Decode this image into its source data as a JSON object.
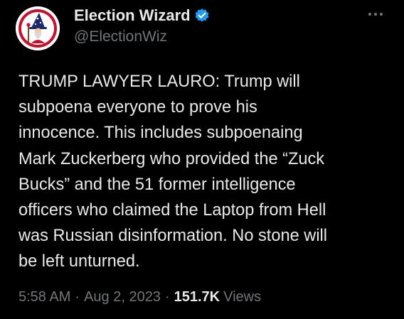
{
  "author": {
    "display_name": "Election Wizard",
    "handle": "@ElectionWiz",
    "verified_icon": "verified-badge-icon",
    "avatar_icon": "wizard-avatar"
  },
  "tweet": {
    "text": "TRUMP LAWYER LAURO: Trump will\nsubpoena everyone to prove his\ninnocence. This includes subpoenaing\nMark Zuckerberg who provided the “Zuck\nBucks” and the 51 former intelligence\nofficers who claimed the Laptop from Hell\nwas Russian disinformation. No stone will\nbe left unturned."
  },
  "meta": {
    "time": "5:58 AM",
    "separator": "·",
    "date": "Aug 2, 2023",
    "views_count": "151.7K",
    "views_label": "Views"
  },
  "colors": {
    "background": "#000000",
    "primary_text": "#e7e9ea",
    "secondary_text": "#71767b",
    "verified_blue": "#1d9bf0"
  },
  "menu": {
    "more_icon": "more-horizontal-icon"
  }
}
